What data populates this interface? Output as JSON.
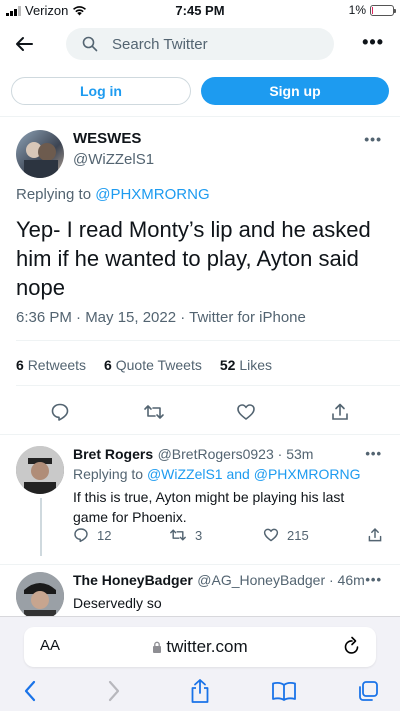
{
  "status_bar": {
    "carrier": "Verizon",
    "time": "7:45 PM",
    "battery": "1%",
    "battery_level": 0.01
  },
  "nav": {
    "search_placeholder": "Search Twitter"
  },
  "auth": {
    "login_label": "Log in",
    "signup_label": "Sign up"
  },
  "main_tweet": {
    "name": "WESWES",
    "handle": "@WiZZelS1",
    "replying_label": "Replying to",
    "replying_to": "@PHXMRORNG",
    "text": "Yep- I read Monty’s lip and he asked him if he wanted to play, Ayton said nope",
    "meta": "6:36 PM · May 15, 2022 · Twitter for iPhone",
    "stats": {
      "retweets_count": "6",
      "retweets_label": "Retweets",
      "quotes_count": "6",
      "quotes_label": "Quote Tweets",
      "likes_count": "52",
      "likes_label": "Likes"
    }
  },
  "replies": [
    {
      "name": "Bret Rogers",
      "handle": "@BretRogers0923 · 53m",
      "replying_label": "Replying to",
      "replying_to": "@WiZZelS1 and @PHXMRORNG",
      "text": "If this is true, Ayton might be playing his last game for Phoenix.",
      "reply_count": "12",
      "retweet_count": "3",
      "like_count": "215"
    },
    {
      "name": "The HoneyBadger",
      "handle": "@AG_HoneyBadger · 46m",
      "text": "Deservedly so"
    }
  ],
  "browser": {
    "text_size_label": "AA",
    "url": "twitter.com"
  }
}
